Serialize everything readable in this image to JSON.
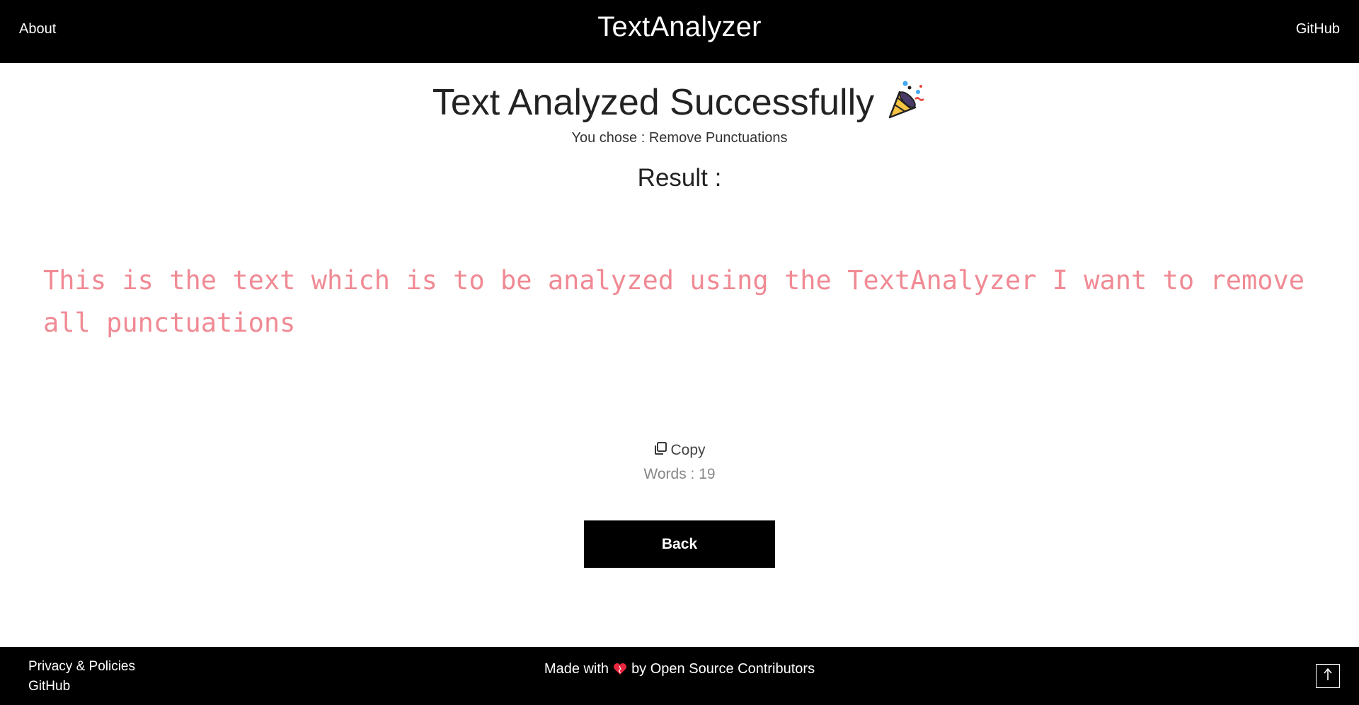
{
  "header": {
    "about_label": "About",
    "brand": "TextAnalyzer",
    "github_label": "GitHub"
  },
  "main": {
    "headline": "Text Analyzed Successfully",
    "headline_icon": "party-popper-icon",
    "chose_prefix": "You chose : ",
    "chose_value": "Remove Punctuations",
    "result_label": "Result :",
    "result_text": "This is the text which is to be analyzed using the TextAnalyzer I want to remove all punctuations",
    "result_color": "#f08a94",
    "copy_label": "Copy",
    "copy_icon": "copy-icon",
    "words_label": "Words : 19",
    "back_label": "Back"
  },
  "footer": {
    "privacy_label": "Privacy & Policies",
    "github_label": "GitHub",
    "made_prefix": "Made with",
    "made_suffix": "by Open Source Contributors",
    "heart_icon": "heart-icon",
    "scroll_top_icon": "arrow-up-icon"
  }
}
